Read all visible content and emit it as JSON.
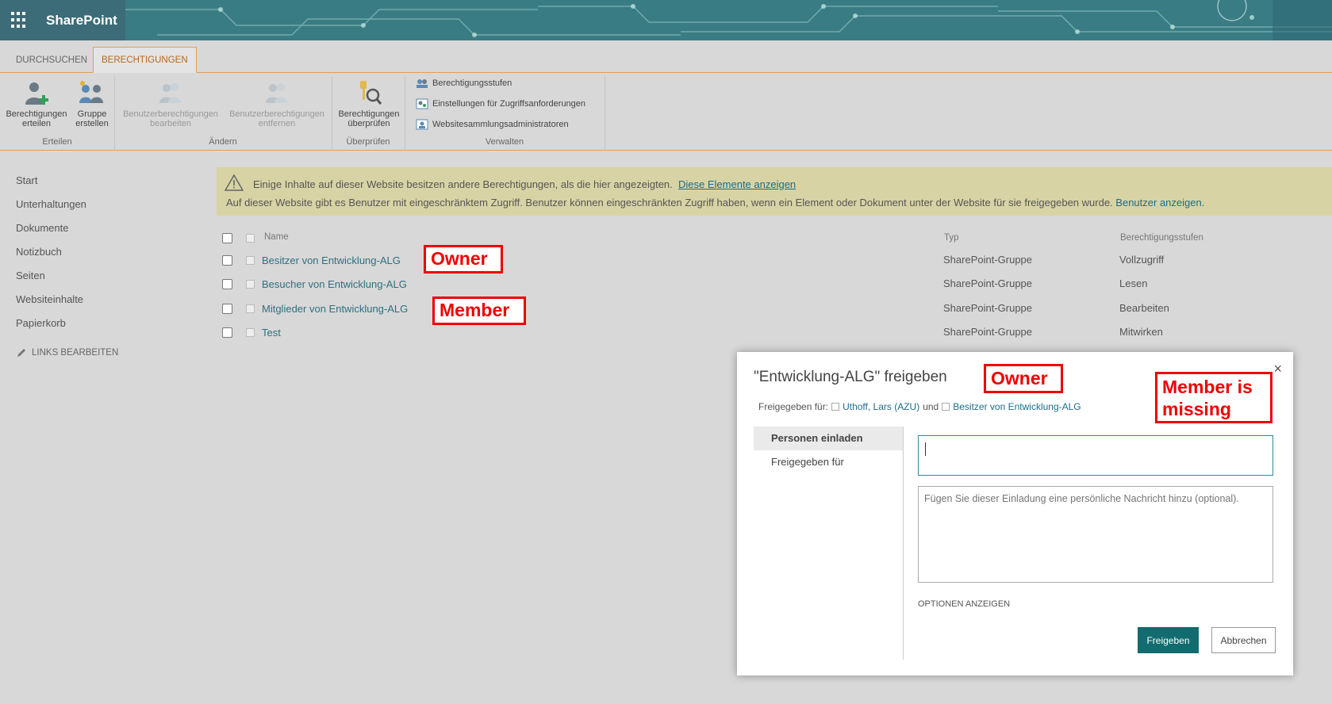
{
  "app": {
    "name": "SharePoint"
  },
  "ribbon": {
    "tabs": [
      {
        "label": "DURCHSUCHEN"
      },
      {
        "label": "BERECHTIGUNGEN"
      }
    ],
    "groups": {
      "erteilen": {
        "label": "Erteilen",
        "buttons": [
          {
            "line1": "Berechtigungen",
            "line2": "erteilen"
          },
          {
            "line1": "Gruppe",
            "line2": "erstellen"
          }
        ]
      },
      "aendern": {
        "label": "Ändern",
        "buttons": [
          {
            "line1": "Benutzerberechtigungen",
            "line2": "bearbeiten"
          },
          {
            "line1": "Benutzerberechtigungen",
            "line2": "entfernen"
          }
        ]
      },
      "ueberpruefen": {
        "label": "Überprüfen",
        "buttons": [
          {
            "line1": "Berechtigungen",
            "line2": "überprüfen"
          }
        ]
      },
      "verwalten": {
        "label": "Verwalten",
        "items": [
          "Berechtigungsstufen",
          "Einstellungen für Zugriffsanforderungen",
          "Websitesammlungsadministratoren"
        ]
      }
    }
  },
  "leftnav": {
    "items": [
      "Start",
      "Unterhaltungen",
      "Dokumente",
      "Notizbuch",
      "Seiten",
      "Websiteinhalte",
      "Papierkorb"
    ],
    "edit_links": "LINKS BEARBEITEN"
  },
  "warning": {
    "line1": "Einige Inhalte auf dieser Website besitzen andere Berechtigungen, als die hier angezeigten.",
    "line1_link": "Diese Elemente anzeigen",
    "line2": "Auf dieser Website gibt es Benutzer mit eingeschränktem Zugriff. Benutzer können eingeschränkten Zugriff haben, wenn ein Element oder Dokument unter der Website für sie freigegeben wurde.",
    "line2_link": "Benutzer anzeigen."
  },
  "table": {
    "headers": {
      "name": "Name",
      "type": "Typ",
      "level": "Berechtigungsstufen"
    },
    "rows": [
      {
        "name": "Besitzer von Entwicklung-ALG",
        "type": "SharePoint-Gruppe",
        "level": "Vollzugriff"
      },
      {
        "name": "Besucher von Entwicklung-ALG",
        "type": "SharePoint-Gruppe",
        "level": "Lesen"
      },
      {
        "name": "Mitglieder von Entwicklung-ALG",
        "type": "SharePoint-Gruppe",
        "level": "Bearbeiten"
      },
      {
        "name": "Test",
        "type": "SharePoint-Gruppe",
        "level": "Mitwirken"
      }
    ]
  },
  "callouts": {
    "owner": "Owner",
    "member": "Member",
    "dialog_owner": "Owner",
    "missing_1": "Member is",
    "missing_2": "missing"
  },
  "dialog": {
    "title": "\"Entwicklung-ALG\" freigeben",
    "close": "×",
    "shared_prefix": "Freigegeben für:",
    "shared_user": "Uthoff, Lars (AZU)",
    "shared_and": "und",
    "shared_group": "Besitzer von Entwicklung-ALG",
    "tabs": [
      "Personen einladen",
      "Freigegeben für"
    ],
    "message_placeholder": "Fügen Sie dieser Einladung eine persönliche Nachricht hinzu (optional).",
    "options_label": "OPTIONEN ANZEIGEN",
    "share_button": "Freigeben",
    "cancel_button": "Abbrechen"
  },
  "colors": {
    "accent": "#126b6e",
    "link": "#1b6d8c",
    "ribbon_accent": "#e0a050",
    "callout": "#e00000",
    "warning_bg": "#d8d3a4"
  }
}
